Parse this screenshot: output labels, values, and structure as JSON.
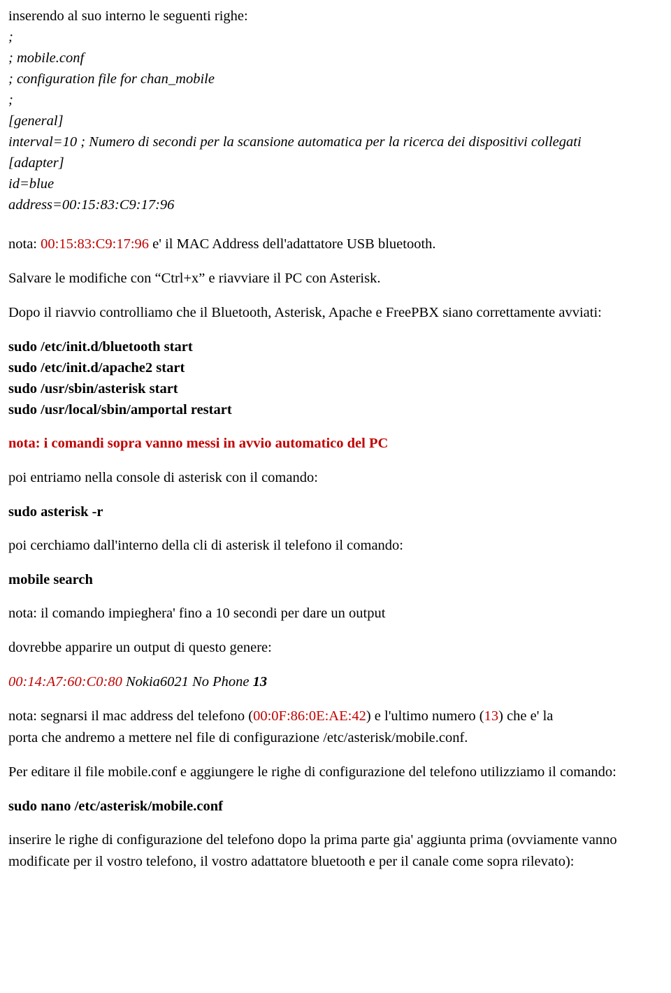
{
  "document": {
    "intro_line": "inserendo al suo interno le seguenti righe:",
    "config_block": [
      ";",
      "; mobile.conf",
      "; configuration file for chan_mobile",
      ";",
      "[general]",
      "interval=10 ; Numero di secondi per la scansione automatica per la ricerca dei dispositivi collegati",
      "[adapter]",
      "id=blue",
      "address=00:15:83:C9:17:96"
    ],
    "nota_mac": {
      "prefix": "nota: ",
      "mac": "00:15:83:C9:17:96",
      "suffix": " e' il MAC Address dell'adattatore USB bluetooth."
    },
    "salvare": "Salvare le modifiche con “Ctrl+x” e riavviare il PC con Asterisk.",
    "dopo_riavvio": "Dopo  il riavvio controlliamo che il Bluetooth, Asterisk, Apache e FreePBX siano correttamente avviati:",
    "commands_start": [
      "sudo /etc/init.d/bluetooth start",
      "sudo /etc/init.d/apache2 start",
      "sudo /usr/sbin/asterisk start",
      "sudo /usr/local/sbin/amportal restart"
    ],
    "nota_avvio_automatico": "nota: i comandi sopra vanno messi in avvio automatico del PC",
    "poi_entriamo": "poi entriamo nella console di asterisk con il comando:",
    "cmd_asterisk_r": "sudo asterisk -r",
    "poi_cerchiamo": "poi cerchiamo dall'interno della cli di asterisk il telefono il comando:",
    "cmd_mobile_search": "mobile search",
    "nota_output": "nota: il comando impieghera' fino a 10 secondi per dare un output",
    "dovrebbe_apparire": "dovrebbe apparire un output di questo genere:",
    "output_example": {
      "mac": "00:14:A7:60:C0:80",
      "device": " Nokia6021 No Phone ",
      "port": "13"
    },
    "nota_segnarsi": {
      "p1": "nota: segnarsi il mac address del telefono (",
      "mac": "00:0F:86:0E:AE:42",
      "p2": ") e l'ultimo numero (",
      "port": "13",
      "p3": ") che e' la",
      "line2": "porta che andremo a mettere nel file di configurazione /etc/asterisk/mobile.conf."
    },
    "per_editare": "Per editare  il file mobile.conf e aggiungere le righe di configurazione del telefono utilizziamo il comando:",
    "cmd_nano": "sudo nano /etc/asterisk/mobile.conf",
    "inserire_righe": "inserire le righe di configurazione del telefono dopo la prima parte gia' aggiunta prima (ovviamente vanno modificate per il vostro telefono, il vostro adattatore bluetooth e per il canale come sopra rilevato):"
  }
}
